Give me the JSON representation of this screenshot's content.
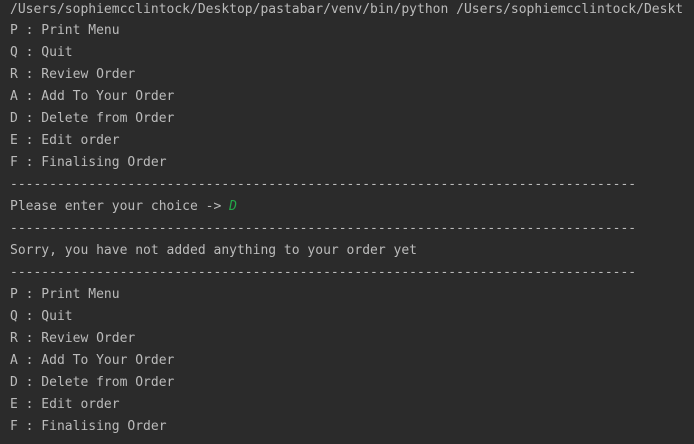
{
  "console": {
    "command_line": "/Users/sophiemcclintock/Desktop/pastabar/venv/bin/python /Users/sophiemcclintock/Deskt",
    "menu_first": [
      "P : Print Menu",
      "Q : Quit",
      "R : Review Order",
      "A : Add To Your Order",
      "D : Delete from Order",
      "E : Edit order",
      "F : Finalising Order"
    ],
    "separator": "--------------------------------------------------------------------------------",
    "prompt": "Please enter your choice -> ",
    "user_input": "D",
    "message": "Sorry, you have not added anything to your order yet",
    "menu_second": [
      "P : Print Menu",
      "Q : Quit",
      "R : Review Order",
      "A : Add To Your Order",
      "D : Delete from Order",
      "E : Edit order",
      "F : Finalising Order"
    ],
    "colors": {
      "background": "#2b2b2b",
      "text": "#bbbbbb",
      "user_input": "#23a94a"
    }
  }
}
